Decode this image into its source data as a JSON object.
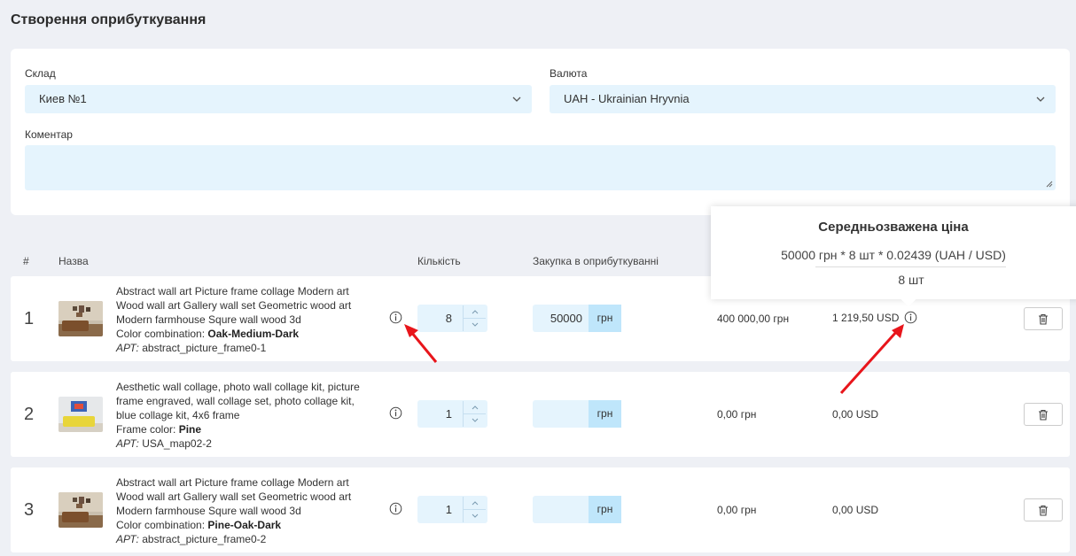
{
  "page": {
    "title": "Створення оприбуткування"
  },
  "form": {
    "warehouse_label": "Склад",
    "warehouse_value": "Киев №1",
    "currency_label": "Валюта",
    "currency_value": "UAH - Ukrainian Hryvnia",
    "comment_label": "Коментар",
    "comment_value": ""
  },
  "table": {
    "headers": {
      "num": "#",
      "name": "Назва",
      "qty": "Кількість",
      "purchase": "Закупка в оприбуткуванні"
    },
    "rows": [
      {
        "num": "1",
        "name": "Abstract wall art Picture frame collage Modern art Wood wall art Gallery wall set Geometric wood art Modern farmhouse Squre wall wood 3d",
        "attr_label": "Color combination:",
        "attr_value": "Oak-Medium-Dark",
        "art_label": "АРТ:",
        "art_value": "abstract_picture_frame0-1",
        "qty": "8",
        "price": "50000",
        "currency": "грн",
        "total_uah": "400 000,00 грн",
        "total_usd": "1 219,50 USD"
      },
      {
        "num": "2",
        "name": "Aesthetic wall collage, photo wall collage kit, picture frame engraved, wall collage set, photo collage kit, blue collage kit, 4x6 frame",
        "attr_label": "Frame color:",
        "attr_value": "Pine",
        "art_label": "АРТ:",
        "art_value": "USA_map02-2",
        "qty": "1",
        "price": "",
        "currency": "грн",
        "total_uah": "0,00 грн",
        "total_usd": "0,00 USD"
      },
      {
        "num": "3",
        "name": "Abstract wall art Picture frame collage Modern art Wood wall art Gallery wall set Geometric wood art Modern farmhouse Squre wall wood 3d",
        "attr_label": "Color combination:",
        "attr_value": "Pine-Oak-Dark",
        "art_label": "АРТ:",
        "art_value": "abstract_picture_frame0-2",
        "qty": "1",
        "price": "",
        "currency": "грн",
        "total_uah": "0,00 грн",
        "total_usd": "0,00 USD"
      }
    ]
  },
  "tooltip": {
    "title": "Середньозважена ціна",
    "formula": "50000 грн * 8 шт * 0.02439 (UAH / USD)",
    "denominator": "8 шт"
  },
  "icons": {
    "dropdown": "chevron-down-icon",
    "info": "info-icon",
    "delete": "trash-icon",
    "annotation": "red-arrow",
    "spin_up": "chevron-up-icon",
    "spin_down": "chevron-down-icon"
  },
  "colors": {
    "input_bg": "#e5f4fd",
    "currency_bg": "#bfe6fb",
    "arrow": "#e8151b",
    "page_bg": "#eef0f5"
  }
}
